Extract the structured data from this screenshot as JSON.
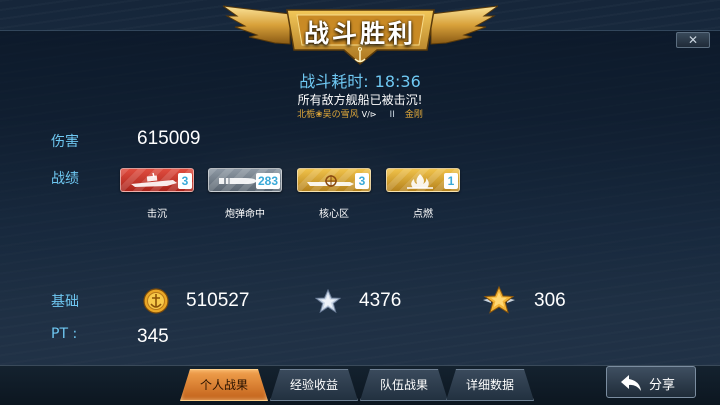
{
  "header": {
    "title": "战斗胜利",
    "close_label": "✕"
  },
  "battle": {
    "time_label": "战斗耗时:",
    "time_value": "18:36",
    "result_text": "所有敌方舰船已被击沉!",
    "player_ship": "北栀❀吴の雪风",
    "vs_mark": "V/⊳",
    "separator": "II",
    "enemy_ship": "金刚"
  },
  "stats": {
    "damage_label": "伤害",
    "damage_value": "615009",
    "record_label": "战绩",
    "base_label": "基础",
    "pt_label": "PT :",
    "pt_value": "345",
    "coins_value": "510527",
    "silver_star_value": "4376",
    "gold_star_value": "306"
  },
  "badges": [
    {
      "label": "击沉",
      "count": "3",
      "icon": "sunk-ship-icon",
      "color": "#c9322a"
    },
    {
      "label": "炮弹命中",
      "count": "283",
      "icon": "shell-icon",
      "color": "#76828d"
    },
    {
      "label": "核心区",
      "count": "3",
      "icon": "citadel-icon",
      "color": "#d9a232"
    },
    {
      "label": "点燃",
      "count": "1",
      "icon": "fire-icon",
      "color": "#d9a232"
    }
  ],
  "tabs": [
    {
      "label": "个人战果",
      "active": true
    },
    {
      "label": "经验收益",
      "active": false
    },
    {
      "label": "队伍战果",
      "active": false
    },
    {
      "label": "详细数据",
      "active": false
    }
  ],
  "share": {
    "label": "分享",
    "icon": "share-arrow-icon"
  },
  "colors": {
    "accent_blue": "#6fc8f2",
    "active_tab": "#e8852e",
    "ship_name": "#e0a83a"
  }
}
